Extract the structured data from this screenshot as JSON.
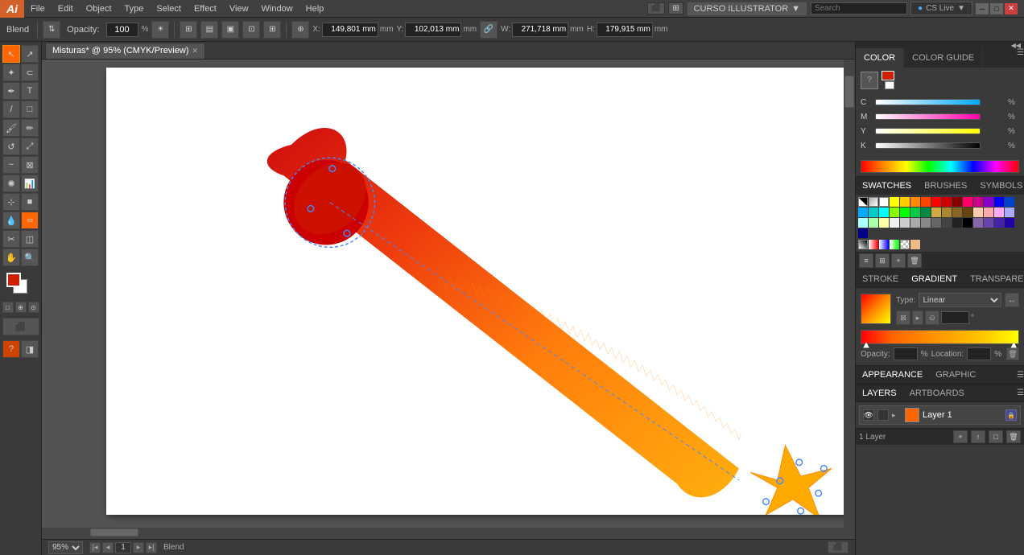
{
  "app": {
    "logo": "Ai",
    "title": "CURSO ILLUSTRATOR",
    "search_placeholder": "Search",
    "cs_live": "CS Live"
  },
  "menubar": {
    "items": [
      "File",
      "Edit",
      "Object",
      "Type",
      "Select",
      "Effect",
      "View",
      "Window",
      "Help"
    ]
  },
  "toolbar": {
    "mode_label": "Blend",
    "opacity_label": "Opacity:",
    "opacity_value": "100",
    "opacity_unit": "%",
    "x_label": "X:",
    "x_value": "149,801 mm",
    "y_label": "Y:",
    "y_value": "102,013 mm",
    "w_label": "W:",
    "w_value": "271,718 mm",
    "h_label": "H:",
    "h_value": "179,915 mm"
  },
  "tab": {
    "title": "Misturas* @ 95% (CMYK/Preview)"
  },
  "bottombar": {
    "zoom": "95%",
    "page": "1",
    "mode": "Blend",
    "layers_label": "1 Layer"
  },
  "color_panel": {
    "tab1": "COLOR",
    "tab2": "COLOR GUIDE",
    "channel_c": "C",
    "channel_m": "M",
    "channel_y": "Y",
    "channel_k": "K",
    "val_c": "",
    "val_m": "",
    "val_y": "",
    "val_k": ""
  },
  "swatches_panel": {
    "tab1": "SWATCHES",
    "tab2": "BRUSHES",
    "tab3": "SYMBOLS"
  },
  "gradient_panel": {
    "tab1": "STROKE",
    "tab2": "GRADIENT",
    "tab3": "TRANSPARENCY",
    "type_label": "Type:",
    "type_value": "",
    "opacity_label": "Opacity:",
    "opacity_value": "",
    "opacity_unit": "%",
    "location_label": "Location:",
    "location_value": "",
    "location_unit": "%"
  },
  "appearance_panel": {
    "tab1": "APPEARANCE",
    "tab2": "GRAPHIC STYLES"
  },
  "layers_panel": {
    "tab1": "LAYERS",
    "tab2": "ARTBOARDS",
    "layer_name": "Layer 1",
    "layers_count": "1 Layer"
  }
}
